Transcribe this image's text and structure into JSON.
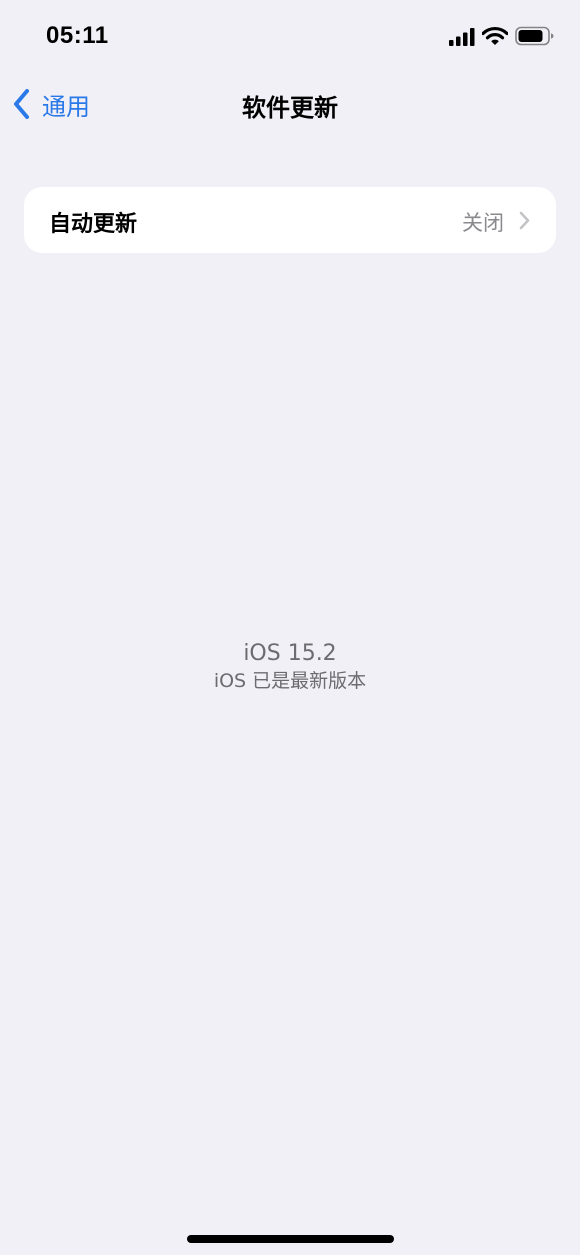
{
  "status_bar": {
    "time": "05:11",
    "icons": [
      "signal-icon",
      "wifi-icon",
      "battery-icon"
    ]
  },
  "nav": {
    "back_label": "通用",
    "title": "软件更新"
  },
  "settings": {
    "auto_update": {
      "label": "自动更新",
      "value": "关闭"
    }
  },
  "version": {
    "number": "iOS 15.2",
    "status": "iOS 已是最新版本"
  },
  "colors": {
    "background": "#f0f0f6",
    "accent": "#2a79e8",
    "secondary_text": "#8a8a8e"
  }
}
